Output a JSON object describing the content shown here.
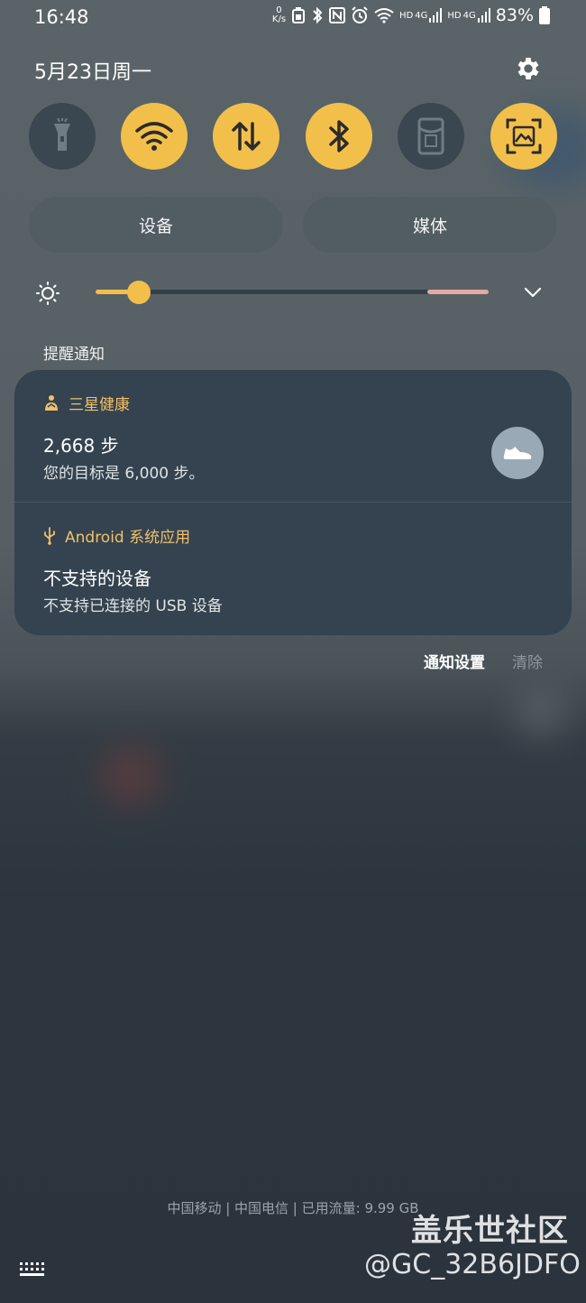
{
  "status_bar": {
    "time": "16:48",
    "net_speed_top": "0",
    "net_speed_unit": "K/s",
    "sim1_label": "HD",
    "sim1_network": "4G",
    "sim2_label": "HD",
    "sim2_network": "4G",
    "battery": "83%"
  },
  "panel": {
    "date": "5月23日周一"
  },
  "quick_tiles": [
    {
      "icon": "flashlight-icon",
      "state": "off"
    },
    {
      "icon": "wifi-icon",
      "state": "on"
    },
    {
      "icon": "mobile-data-icon",
      "state": "on"
    },
    {
      "icon": "bluetooth-icon",
      "state": "on"
    },
    {
      "icon": "red-envelope-icon",
      "state": "off"
    },
    {
      "icon": "screenshot-icon",
      "state": "on"
    }
  ],
  "output_buttons": {
    "devices": "设备",
    "media": "媒体"
  },
  "brightness": {
    "level": 0.11
  },
  "notifications": {
    "section_title": "提醒通知",
    "items": [
      {
        "app": "三星健康",
        "title": "2,668 步",
        "body": "您的目标是 6,000 步。"
      },
      {
        "app": "Android 系统应用",
        "title": "不支持的设备",
        "body": "不支持已连接的 USB 设备"
      }
    ],
    "settings_label": "通知设置",
    "clear_label": "清除"
  },
  "footer": {
    "carrier_text": "中国移动 | 中国电信 | 已用流量: 9.99 GB"
  },
  "watermark": {
    "line1": "盖乐世社区",
    "line2": "@GC_32B6JDFO"
  },
  "colors": {
    "accent": "#f2c04a",
    "card": "#34434f",
    "app_label": "#f0c16a"
  }
}
